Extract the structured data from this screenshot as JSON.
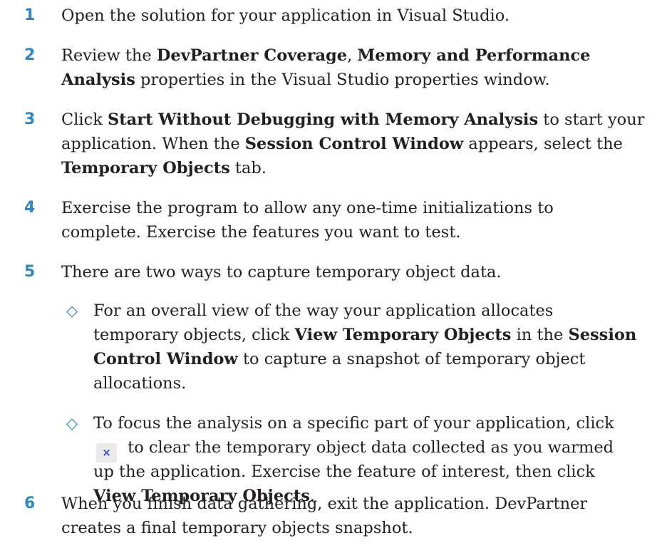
{
  "steps": [
    {
      "number": "1",
      "lines": [
        {
          "t1": "Open the solution for your application in Visual Studio."
        }
      ]
    },
    {
      "number": "2",
      "lines": [
        {
          "t1": "Review the ",
          "b1": "DevPartner Coverage",
          "t2": ", ",
          "b2": "Memory and Performance"
        },
        {
          "b1": "Analysis",
          "t1": " properties in the Visual Studio properties window."
        }
      ]
    },
    {
      "number": "3",
      "lines": [
        {
          "t1": "Click ",
          "b1": "Start Without Debugging with Memory Analysis",
          "t2": " to start your"
        },
        {
          "t1": "application. When the ",
          "b1": "Session Control Window",
          "t2": " appears, select the"
        },
        {
          "b1": "Temporary Objects",
          "t1": " tab."
        }
      ]
    },
    {
      "number": "4",
      "lines": [
        {
          "t1": "Exercise the program to allow any one-time initializations to"
        },
        {
          "t1": "complete. Exercise the features you want to test."
        }
      ]
    },
    {
      "number": "5",
      "lines": [
        {
          "t1": "There are two ways to capture temporary object data."
        }
      ]
    },
    {
      "number": "6",
      "lines": [
        {
          "t1": "When you finish data gathering, exit the application. DevPartner"
        },
        {
          "t1": "creates a final temporary objects snapshot."
        }
      ]
    }
  ],
  "substeps": [
    {
      "marker": "◇",
      "lines": [
        {
          "t1": "For an overall view of the way your application allocates"
        },
        {
          "t1": "temporary objects, click ",
          "b1": "View Temporary Objects",
          "t2": " in the ",
          "b2": "Session"
        },
        {
          "b1": "Control Window",
          "t1": " to capture a snapshot of temporary object"
        },
        {
          "t1": "allocations."
        }
      ]
    },
    {
      "marker": "◇",
      "icon": "clear-data-icon",
      "icon_glyph": "×",
      "lines": [
        {
          "t1": "To focus the analysis on a specific part of your application, click"
        },
        {
          "t1": " to clear the temporary object data collected as you warmed"
        },
        {
          "t1": "up the application. Exercise the feature of interest, then click"
        },
        {
          "b1": "View Temporary Objects",
          "t1": "."
        }
      ]
    }
  ],
  "colors": {
    "accent": "#2f86c4",
    "text": "#231f20"
  }
}
